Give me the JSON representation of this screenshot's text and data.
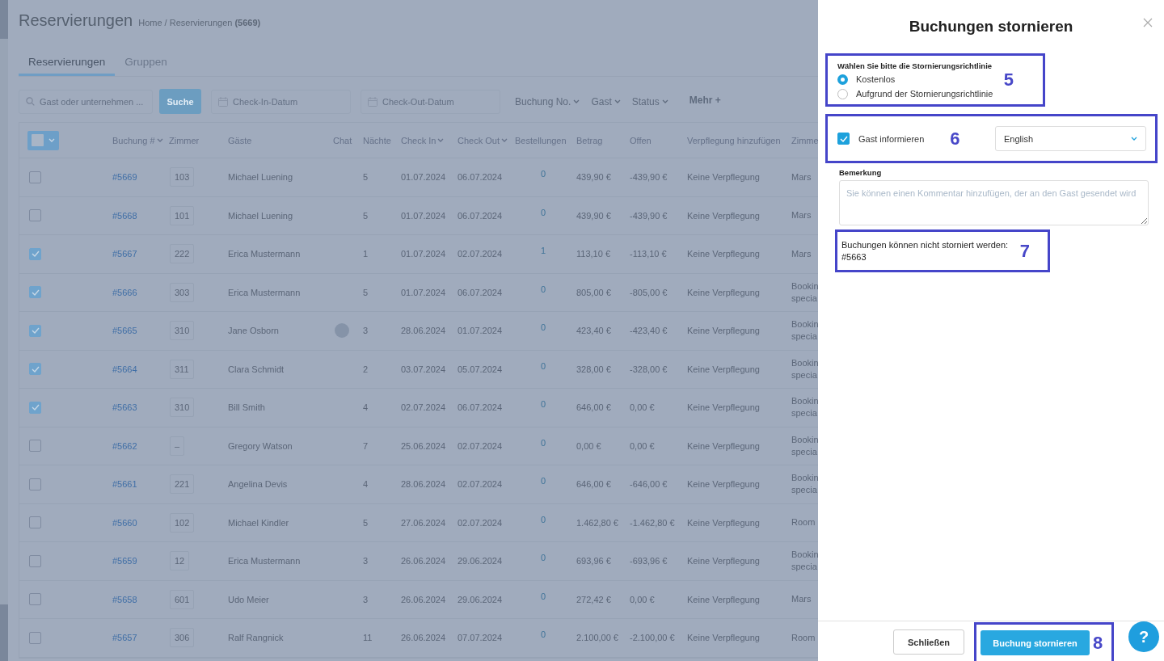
{
  "page": {
    "title": "Reservierungen",
    "breadcrumb_home": "Home",
    "breadcrumb_separator": "/",
    "breadcrumb_current": "Reservierungen",
    "breadcrumb_count": "(5669)"
  },
  "tabs": [
    {
      "label": "Reservierungen",
      "selected": true
    },
    {
      "label": "Gruppen",
      "selected": false
    }
  ],
  "filters": {
    "search_placeholder": "Gast oder unternehmen ...",
    "search_button": "Suche",
    "checkin_placeholder": "Check-In-Datum",
    "checkout_placeholder": "Check-Out-Datum",
    "dropdowns": [
      "Buchung No.",
      "Gast",
      "Status"
    ],
    "more": "Mehr +"
  },
  "table": {
    "columns": [
      {
        "label": "Buchung #",
        "sortable": true
      },
      {
        "label": "Zimmer",
        "sortable": false
      },
      {
        "label": "Gäste",
        "sortable": false
      },
      {
        "label": "Chat",
        "sortable": false
      },
      {
        "label": "Nächte",
        "sortable": false
      },
      {
        "label": "Check In",
        "sortable": true
      },
      {
        "label": "Check Out",
        "sortable": true
      },
      {
        "label": "Bestellungen",
        "sortable": false
      },
      {
        "label": "Betrag",
        "sortable": false
      },
      {
        "label": "Offen",
        "sortable": false
      },
      {
        "label": "Verpflegung hinzufügen",
        "sortable": false
      },
      {
        "label": "Zimme",
        "sortable": false
      }
    ],
    "rows": [
      {
        "checked": false,
        "booking": "#5669",
        "room": "103",
        "guest": "Michael Luening",
        "chat": false,
        "nights": "5",
        "check_in": "01.07.2024",
        "check_out": "06.07.2024",
        "orders": "0",
        "amount": "439,90 €",
        "open": "-439,90 €",
        "board": "Keine Verpflegung",
        "column_13": "Mars"
      },
      {
        "checked": false,
        "booking": "#5668",
        "room": "101",
        "guest": "Michael Luening",
        "chat": false,
        "nights": "5",
        "check_in": "01.07.2024",
        "check_out": "06.07.2024",
        "orders": "0",
        "amount": "439,90 €",
        "open": "-439,90 €",
        "board": "Keine Verpflegung",
        "column_13": "Mars"
      },
      {
        "checked": true,
        "booking": "#5667",
        "room": "222",
        "guest": "Erica Mustermann",
        "chat": false,
        "nights": "1",
        "check_in": "01.07.2024",
        "check_out": "02.07.2024",
        "orders": "1",
        "amount": "113,10 €",
        "open": "-113,10 €",
        "board": "Keine Verpflegung",
        "column_13": "Mars"
      },
      {
        "checked": true,
        "booking": "#5666",
        "room": "303",
        "guest": "Erica Mustermann",
        "chat": false,
        "nights": "5",
        "check_in": "01.07.2024",
        "check_out": "06.07.2024",
        "orders": "0",
        "amount": "805,00 €",
        "open": "-805,00 €",
        "board": "Keine Verpflegung",
        "column_13": "Bookin specia"
      },
      {
        "checked": true,
        "booking": "#5665",
        "room": "310",
        "guest": "Jane Osborn",
        "chat": true,
        "nights": "3",
        "check_in": "28.06.2024",
        "check_out": "01.07.2024",
        "orders": "0",
        "amount": "423,40 €",
        "open": "-423,40 €",
        "board": "Keine Verpflegung",
        "column_13": "Bookin specia"
      },
      {
        "checked": true,
        "booking": "#5664",
        "room": "311",
        "guest": "Clara Schmidt",
        "chat": false,
        "nights": "2",
        "check_in": "03.07.2024",
        "check_out": "05.07.2024",
        "orders": "0",
        "amount": "328,00 €",
        "open": "-328,00 €",
        "board": "Keine Verpflegung",
        "column_13": "Bookin specia"
      },
      {
        "checked": true,
        "booking": "#5663",
        "room": "310",
        "guest": "Bill Smith",
        "chat": false,
        "nights": "4",
        "check_in": "02.07.2024",
        "check_out": "06.07.2024",
        "orders": "0",
        "amount": "646,00 €",
        "open": "0,00 €",
        "board": "Keine Verpflegung",
        "column_13": "Bookin specia"
      },
      {
        "checked": false,
        "booking": "#5662",
        "room": "–",
        "guest": "Gregory Watson",
        "chat": false,
        "nights": "7",
        "check_in": "25.06.2024",
        "check_out": "02.07.2024",
        "orders": "0",
        "amount": "0,00 €",
        "open": "0,00 €",
        "board": "Keine Verpflegung",
        "column_13": "Bookin specia"
      },
      {
        "checked": false,
        "booking": "#5661",
        "room": "221",
        "guest": "Angelina Devis",
        "chat": false,
        "nights": "4",
        "check_in": "28.06.2024",
        "check_out": "02.07.2024",
        "orders": "0",
        "amount": "646,00 €",
        "open": "-646,00 €",
        "board": "Keine Verpflegung",
        "column_13": "Bookin specia"
      },
      {
        "checked": false,
        "booking": "#5660",
        "room": "102",
        "guest": "Michael Kindler",
        "chat": false,
        "nights": "5",
        "check_in": "27.06.2024",
        "check_out": "02.07.2024",
        "orders": "0",
        "amount": "1.462,80 €",
        "open": "-1.462,80 €",
        "board": "Keine Verpflegung",
        "column_13": "Room"
      },
      {
        "checked": false,
        "booking": "#5659",
        "room": "12",
        "guest": "Erica Mustermann",
        "chat": false,
        "nights": "3",
        "check_in": "26.06.2024",
        "check_out": "29.06.2024",
        "orders": "0",
        "amount": "693,96 €",
        "open": "-693,96 €",
        "board": "Keine Verpflegung",
        "column_13": "Bookin specia"
      },
      {
        "checked": false,
        "booking": "#5658",
        "room": "601",
        "guest": "Udo Meier",
        "chat": false,
        "nights": "3",
        "check_in": "26.06.2024",
        "check_out": "29.06.2024",
        "orders": "0",
        "amount": "272,42 €",
        "open": "0,00 €",
        "board": "Keine Verpflegung",
        "column_13": "Mars"
      },
      {
        "checked": false,
        "booking": "#5657",
        "room": "306",
        "guest": "Ralf Rangnick",
        "chat": false,
        "nights": "11",
        "check_in": "26.06.2024",
        "check_out": "07.07.2024",
        "orders": "0",
        "amount": "2.100,00 €",
        "open": "-2.100,00 €",
        "board": "Keine Verpflegung",
        "column_13": "Room"
      }
    ]
  },
  "dialog": {
    "title": "Buchungen stornieren",
    "policy": {
      "label": "Wählen Sie bitte die Stornierungsrichtlinie",
      "callout": "5",
      "options": [
        {
          "label": "Kostenlos",
          "selected": true
        },
        {
          "label": "Aufgrund der Stornierungsrichtlinie",
          "selected": false
        }
      ]
    },
    "notify": {
      "label": "Gast informieren",
      "checked": true,
      "language": "English",
      "callout": "6"
    },
    "remark": {
      "label": "Bemerkung",
      "placeholder": "Sie können einen Kommentar hinzufügen, der an den Gast gesendet wird"
    },
    "warning": {
      "text": "Buchungen können nicht storniert werden:",
      "bookings": "#5663",
      "callout": "7"
    },
    "buttons": {
      "close": "Schließen",
      "confirm": "Buchung stornieren",
      "callout": "8"
    },
    "help": "?"
  }
}
